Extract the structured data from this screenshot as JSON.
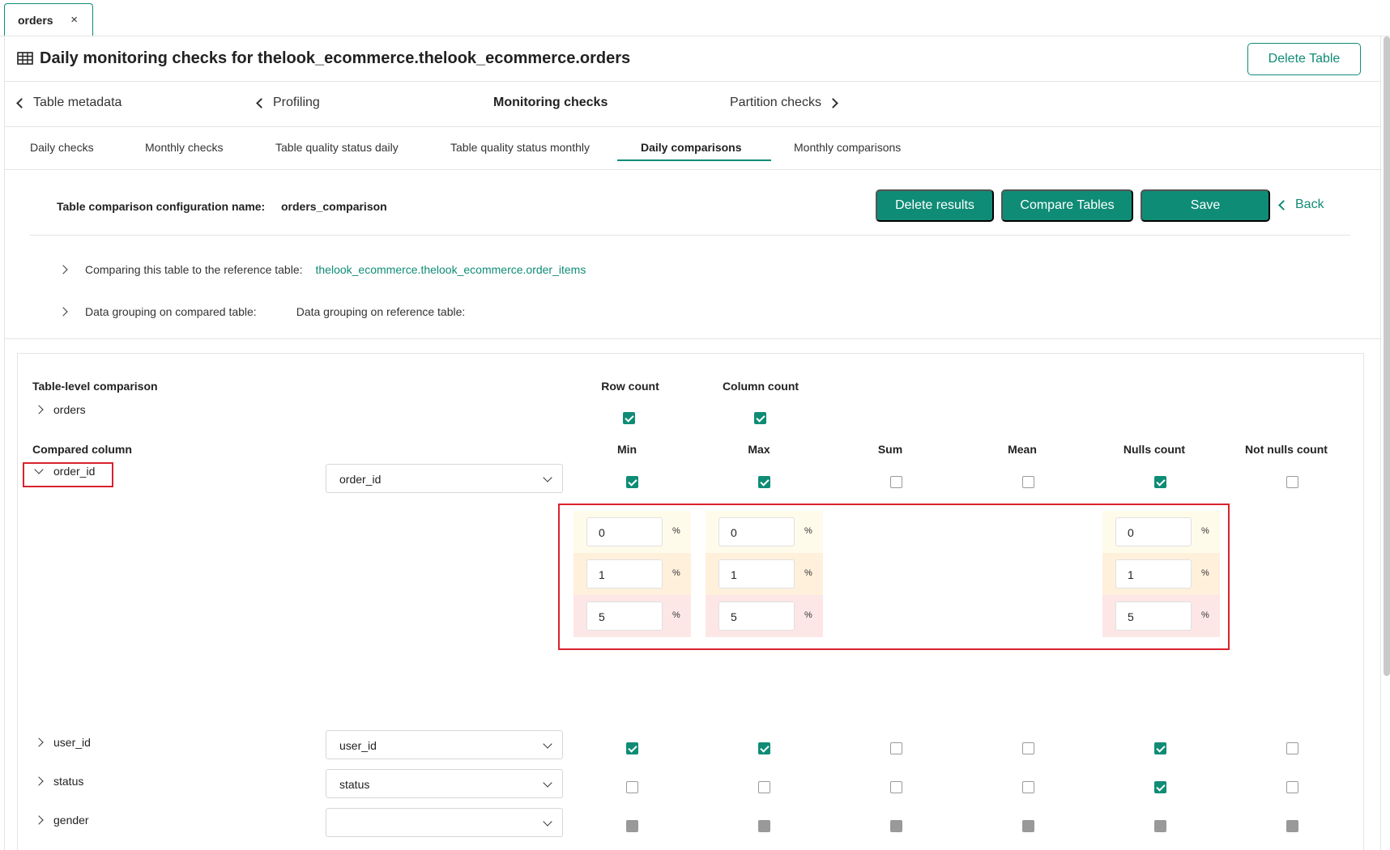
{
  "tab": {
    "label": "orders",
    "close_icon": "×"
  },
  "header": {
    "title": "Daily monitoring checks for thelook_ecommerce.thelook_ecommerce.orders",
    "delete_table": "Delete Table"
  },
  "nav": {
    "table_metadata": "Table metadata",
    "profiling": "Profiling",
    "monitoring_checks": "Monitoring checks",
    "partition_checks": "Partition checks"
  },
  "subtabs": [
    "Daily checks",
    "Monthly checks",
    "Table quality status daily",
    "Table quality status monthly",
    "Daily comparisons",
    "Monthly comparisons"
  ],
  "config": {
    "name_label": "Table comparison configuration name:",
    "name_value": "orders_comparison",
    "delete_results": "Delete results",
    "compare_tables": "Compare Tables",
    "save": "Save",
    "back": "Back",
    "reference_label": "Comparing this table to the reference table:",
    "reference_table": "thelook_ecommerce.thelook_ecommerce.order_items",
    "grouping_compared": "Data grouping on compared table:",
    "grouping_reference": "Data grouping on reference table:"
  },
  "table_level": {
    "heading": "Table-level comparison",
    "table_name": "orders",
    "row_count": "Row count",
    "column_count": "Column count",
    "row_count_checked": true,
    "column_count_checked": true
  },
  "columns_section": {
    "heading": "Compared column",
    "headers": [
      "Min",
      "Max",
      "Sum",
      "Mean",
      "Nulls count",
      "Not nulls count"
    ]
  },
  "rows": [
    {
      "name": "order_id",
      "reference": "order_id",
      "expanded": true,
      "checks": [
        "on",
        "on",
        "off",
        "off",
        "on",
        "off"
      ]
    },
    {
      "name": "user_id",
      "reference": "user_id",
      "expanded": false,
      "checks": [
        "on",
        "on",
        "off",
        "off",
        "on",
        "off"
      ]
    },
    {
      "name": "status",
      "reference": "status",
      "expanded": false,
      "checks": [
        "off",
        "off",
        "off",
        "off",
        "on",
        "off"
      ]
    },
    {
      "name": "gender",
      "reference": "",
      "expanded": false,
      "checks": [
        "disabled",
        "disabled",
        "disabled",
        "disabled",
        "disabled",
        "disabled"
      ]
    }
  ],
  "thresholds": {
    "percent_symbol": "%",
    "min": {
      "warning": "0",
      "error": "1",
      "fatal": "5"
    },
    "max": {
      "warning": "0",
      "error": "1",
      "fatal": "5"
    },
    "nulls_count": {
      "warning": "0",
      "error": "1",
      "fatal": "5"
    }
  },
  "colors": {
    "accent": "#0f8c76",
    "highlight": "#d9232e",
    "warning_bg": "#fffbea",
    "error_bg": "#fff0dc",
    "fatal_bg": "#fde6e6"
  }
}
